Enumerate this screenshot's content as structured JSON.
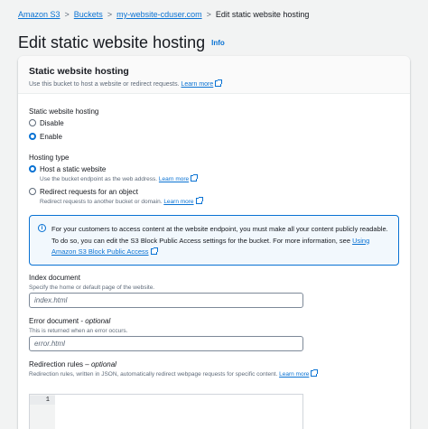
{
  "breadcrumb": {
    "items": [
      "Amazon S3",
      "Buckets",
      "my-website-cduser.com"
    ],
    "current": "Edit static website hosting"
  },
  "page": {
    "title": "Edit static website hosting",
    "info_label": "Info"
  },
  "panel": {
    "title": "Static website hosting",
    "description": "Use this bucket to host a website or redirect requests.",
    "learn_more": "Learn more"
  },
  "hosting": {
    "label": "Static website hosting",
    "options": [
      {
        "label": "Disable",
        "selected": false
      },
      {
        "label": "Enable",
        "selected": true
      }
    ]
  },
  "hosting_type": {
    "label": "Hosting type",
    "options": [
      {
        "label": "Host a static website",
        "description": "Use the bucket endpoint as the web address.",
        "selected": true
      },
      {
        "label": "Redirect requests for an object",
        "description": "Redirect requests to another bucket or domain.",
        "selected": false
      }
    ],
    "learn_more": "Learn more"
  },
  "alert": {
    "text": "For your customers to access content at the website endpoint, you must make all your content publicly readable. To do so, you can edit the S3 Block Public Access settings for the bucket. For more information, see",
    "link": "Using Amazon S3 Block Public Access"
  },
  "index_document": {
    "label": "Index document",
    "description": "Specify the home or default page of the website.",
    "placeholder": "index.html"
  },
  "error_document": {
    "label": "Error document",
    "optional": "optional",
    "description": "This is returned when an error occurs.",
    "placeholder": "error.html"
  },
  "redirection_rules": {
    "label": "Redirection rules",
    "optional": "optional",
    "description": "Redirection rules, written in JSON, automatically redirect webpage requests for specific content.",
    "learn_more": "Learn more",
    "line_number": "1"
  },
  "colors": {
    "accent": "#0972d3",
    "alert_bg": "#f2f8fd",
    "page_bg": "#f2f3f3"
  }
}
